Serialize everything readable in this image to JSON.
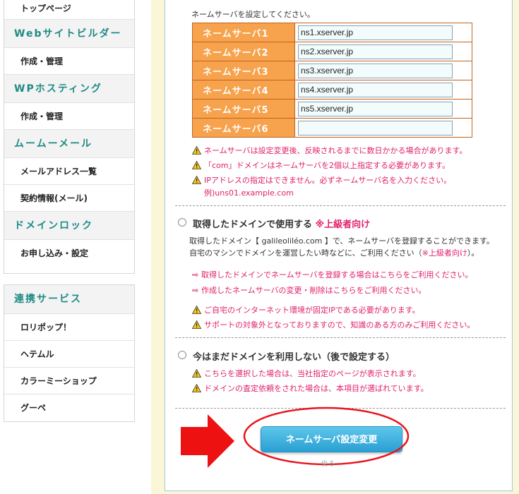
{
  "sidebar": {
    "box1": [
      {
        "type": "item",
        "label": "トップページ"
      },
      {
        "type": "head",
        "label": "Webサイトビルダー"
      },
      {
        "type": "item",
        "label": "作成・管理"
      },
      {
        "type": "head",
        "label": "WPホスティング"
      },
      {
        "type": "item",
        "label": "作成・管理"
      },
      {
        "type": "head",
        "label": "ムームーメール"
      },
      {
        "type": "item",
        "label": "メールアドレス一覧"
      },
      {
        "type": "item",
        "label": "契約情報(メール)"
      },
      {
        "type": "head",
        "label": "ドメインロック"
      },
      {
        "type": "item",
        "label": "お申し込み・設定"
      }
    ],
    "box2_head": "連携サービス",
    "box2": [
      "ロリポップ！",
      "ヘテムル",
      "カラーミーショップ",
      "グーペ"
    ]
  },
  "main": {
    "intro": "ネームサーバを設定してください。",
    "nameservers": [
      {
        "label": "ネームサーバ1",
        "value": "ns1.xserver.jp"
      },
      {
        "label": "ネームサーバ2",
        "value": "ns2.xserver.jp"
      },
      {
        "label": "ネームサーバ3",
        "value": "ns3.xserver.jp"
      },
      {
        "label": "ネームサーバ4",
        "value": "ns4.xserver.jp"
      },
      {
        "label": "ネームサーバ5",
        "value": "ns5.xserver.jp"
      },
      {
        "label": "ネームサーバ6",
        "value": ""
      }
    ],
    "ns_warnings": [
      "ネームサーバは設定変更後、反映されるまでに数日かかる場合があります。",
      "「com」ドメインはネームサーバを2個以上指定する必要があります。",
      "IPアドレスの指定はできません。必ずネームサーバ名を入力ください。"
    ],
    "ns_example": "例)uns01.example.com",
    "option_own": {
      "title": "取得したドメインで使用する",
      "advanced": "※上級者向け",
      "desc1": "取得したドメイン【 galileoliléo.com 】で、ネームサーバを登録することができます。",
      "desc2_pre": "自宅のマシンでドメインを運営したい時などに、ご利用ください（",
      "desc2_red": "※上級者向け",
      "desc2_post": "）。",
      "link1": "取得したドメインでネームサーバを登録する場合はこちらをご利用ください。",
      "link2": "作成したネームサーバの変更・削除はこちらをご利用ください。",
      "warn1": "ご自宅のインターネット環境が固定IPである必要があります。",
      "warn2": "サポートの対象外となっておりますので、知識のある方のみご利用ください。"
    },
    "option_later": {
      "title": "今はまだドメインを利用しない（後で設定する）",
      "warn1": "こちらを選択した場合は、当社指定のページが表示されます。",
      "warn2": "ドメインの査定依頼をされた場合は、本項目が選ばれています。"
    },
    "submit_label": "ネームサーバ設定変更",
    "below_button": "戻る"
  },
  "colors": {
    "label_orange": "#f7a24c",
    "warning_pink": "#e0206a",
    "button_blue": "#2a9fd2",
    "highlight_red": "#e8141c",
    "sidebar_head_teal": "#1f8a86"
  }
}
